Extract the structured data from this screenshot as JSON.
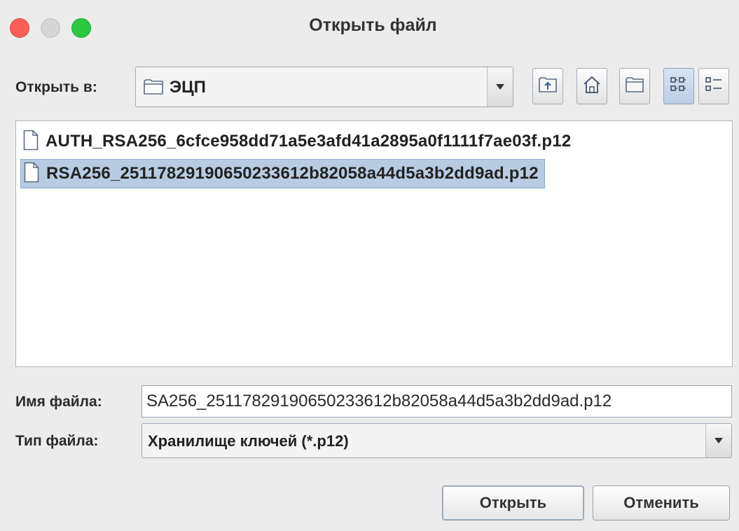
{
  "window": {
    "title": "Открыть файл"
  },
  "location": {
    "label": "Открыть в:",
    "current": "ЭЦП"
  },
  "toolbar": {
    "up_icon": "folder-up-icon",
    "home_icon": "home-icon",
    "new_folder_icon": "new-folder-icon",
    "list_view_icon": "list-view-icon",
    "details_view_icon": "details-view-icon"
  },
  "files": [
    {
      "name": "AUTH_RSA256_6cfce958dd71a5e3afd41a2895a0f1111f7ae03f.p12",
      "selected": false
    },
    {
      "name": "RSA256_25117829190650233612b82058a44d5a3b2dd9ad.p12",
      "selected": true
    }
  ],
  "filename": {
    "label": "Имя файла:",
    "value": "SA256_25117829190650233612b82058a44d5a3b2dd9ad.p12"
  },
  "filetype": {
    "label": "Тип файла:",
    "value": "Хранилище ключей (*.p12)"
  },
  "buttons": {
    "open": "Открыть",
    "cancel": "Отменить"
  },
  "colors": {
    "close": "#fb5f57",
    "minimize": "#d5d5d5",
    "maximize": "#2bc840",
    "selection": "#b7cce3"
  }
}
